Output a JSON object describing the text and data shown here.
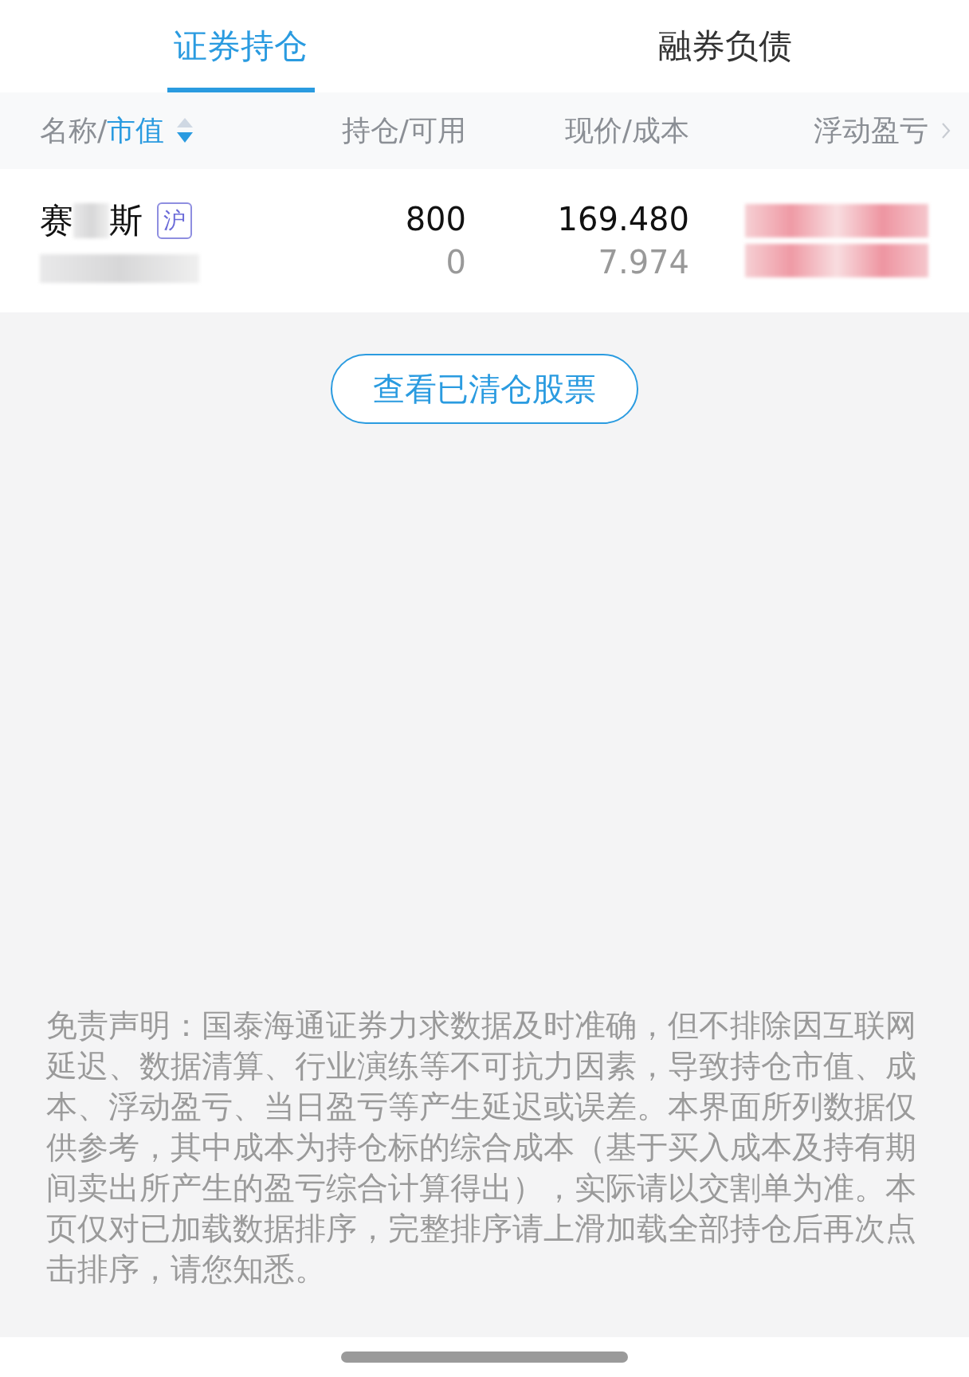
{
  "tabs": [
    {
      "label": "证券持仓",
      "selected": true
    },
    {
      "label": "融券负债",
      "selected": false
    }
  ],
  "table": {
    "columns": [
      {
        "label_plain": "名称/",
        "label_active": "市值",
        "sorted_descending": true
      },
      {
        "label": "持仓/可用"
      },
      {
        "label": "现价/成本"
      },
      {
        "label": "浮动盈亏"
      }
    ],
    "rows": [
      {
        "name_start": "赛",
        "name_end": "斯",
        "market": "沪",
        "holding": "800",
        "available": "0",
        "price": "169.480",
        "cost": "7.974"
      }
    ]
  },
  "cleared_button": "查看已清仓股票",
  "disclaimer": "免责声明：国泰海通证券力求数据及时准确，但不排除因互联网延迟、数据清算、行业演练等不可抗力因素，导致持仓市值、成本、浮动盈亏、当日盈亏等产生延迟或误差。本界面所列数据仅供参考，其中成本为持仓标的综合成本（基于买入成本及持有期间卖出所产生的盈亏综合计算得出），实际请以交割单为准。本页仅对已加载数据排序，完整排序请上滑加载全部持仓后再次点击排序，请您知悉。"
}
